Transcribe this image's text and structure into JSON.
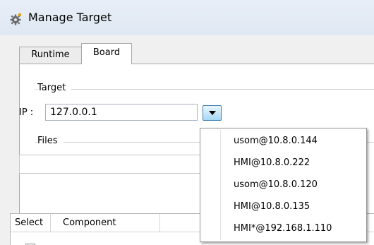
{
  "window": {
    "title": "Manage Target",
    "icon": "gear-icon"
  },
  "tabs": [
    {
      "label": "Runtime",
      "selected": false
    },
    {
      "label": "Board",
      "selected": true
    }
  ],
  "target_group": {
    "label": "Target",
    "ip_label": "IP :",
    "ip_value": "127.0.0.1"
  },
  "files_group": {
    "label": "Files",
    "value": ""
  },
  "table": {
    "columns": [
      "Select",
      "Component",
      ""
    ]
  },
  "dropdown": {
    "options": [
      "usom@10.8.0.144",
      "HMI@10.8.0.222",
      "usom@10.8.0.120",
      "HMI@10.8.0.135",
      "HMI*@192.168.1.110"
    ]
  },
  "colors": {
    "accent_button_border": "#3c7fb1",
    "title_bar": "#dfe8f3"
  }
}
